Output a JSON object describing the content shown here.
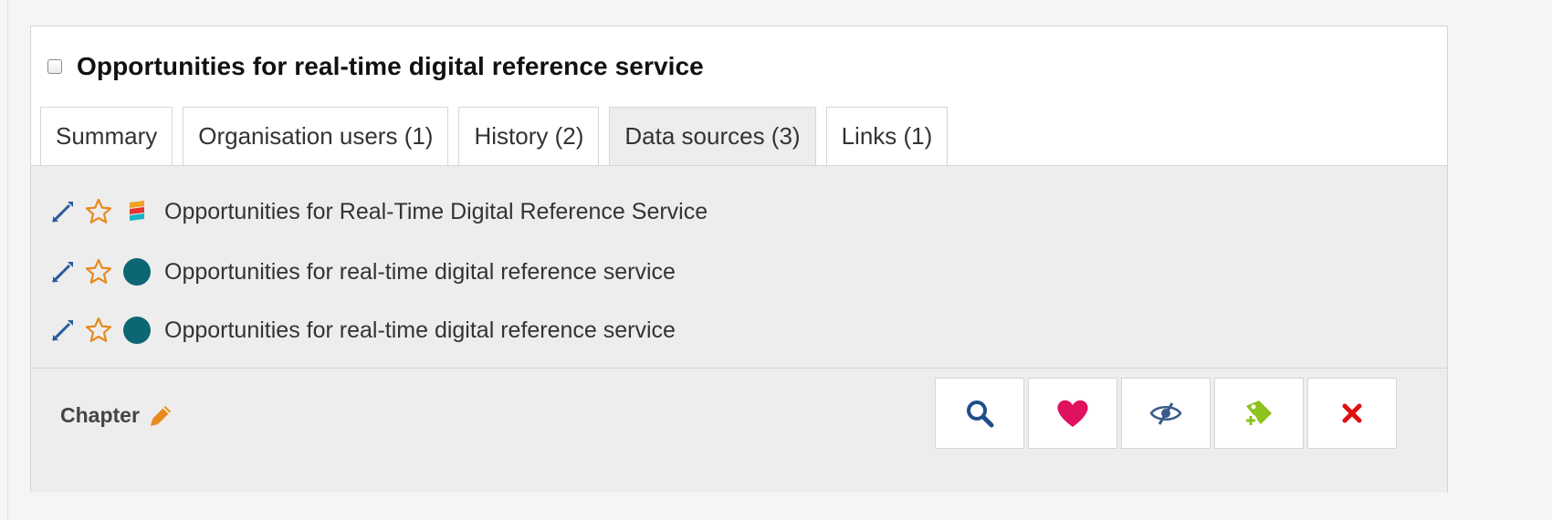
{
  "record": {
    "title": "Opportunities for real-time digital reference service"
  },
  "tabs": [
    {
      "label": "Summary",
      "active": false
    },
    {
      "label": "Organisation users (1)",
      "active": false
    },
    {
      "label": "History (2)",
      "active": false
    },
    {
      "label": "Data sources (3)",
      "active": true
    },
    {
      "label": "Links (1)",
      "active": false
    }
  ],
  "data_sources": [
    {
      "label": "Opportunities for Real-Time Digital Reference Service",
      "source_icon": "stacked-bars-logo-icon"
    },
    {
      "label": "Opportunities for real-time digital reference service",
      "source_icon": "teal-dot-icon"
    },
    {
      "label": "Opportunities for real-time digital reference service",
      "source_icon": "teal-dot-icon"
    }
  ],
  "footer": {
    "chapter_label": "Chapter"
  },
  "actions": [
    {
      "name": "search-icon",
      "color": "#1f4e8c"
    },
    {
      "name": "heart-icon",
      "color": "#e0115f"
    },
    {
      "name": "eye-slash-icon",
      "color": "#3a5a8c"
    },
    {
      "name": "tag-add-icon",
      "color": "#8dc21f"
    },
    {
      "name": "close-icon",
      "color": "#e01010"
    }
  ],
  "colors": {
    "accent_orange": "#e8891d",
    "expand_blue": "#2a5b9f",
    "teal": "#0d6674"
  }
}
